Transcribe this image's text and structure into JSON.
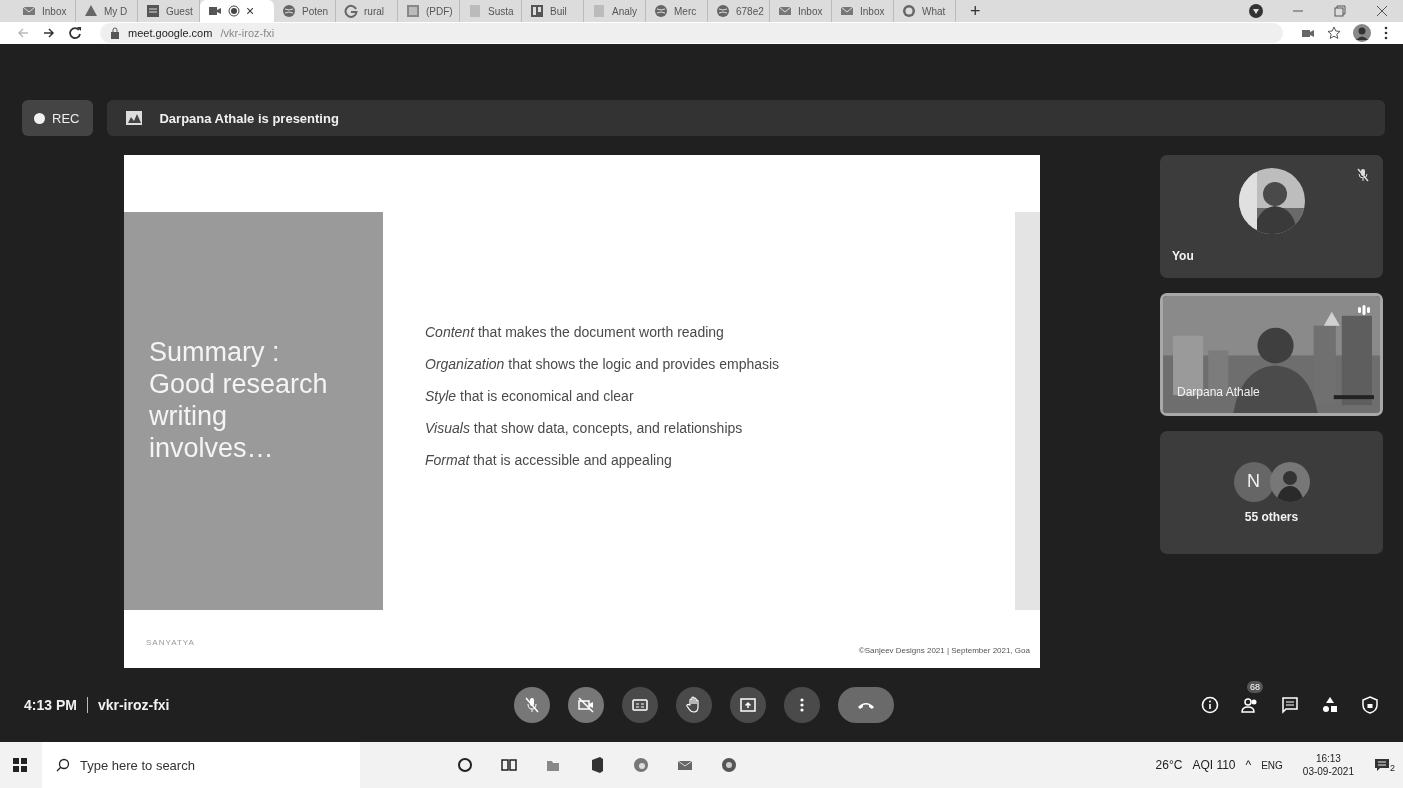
{
  "browser": {
    "tabs": [
      {
        "label": "Inbox",
        "selected": false
      },
      {
        "label": "My D",
        "selected": false
      },
      {
        "label": "Guest",
        "selected": false
      },
      {
        "close": "×",
        "selected": true
      },
      {
        "label": "Poten",
        "selected": false
      },
      {
        "label": "rural",
        "selected": false
      },
      {
        "label": "(PDF)",
        "selected": false
      },
      {
        "label": "Susta",
        "selected": false
      },
      {
        "label": "Buil",
        "selected": false
      },
      {
        "label": "Analy",
        "selected": false
      },
      {
        "label": "Merc",
        "selected": false
      },
      {
        "label": "678e2",
        "selected": false
      },
      {
        "label": "Inbox",
        "selected": false
      },
      {
        "label": "Inbox",
        "selected": false
      },
      {
        "label": "What",
        "selected": false
      }
    ],
    "new_tab": "+",
    "url_domain": "meet.google.com",
    "url_path": "/vkr-iroz-fxi"
  },
  "meet": {
    "recording_label": "REC",
    "presenter_banner": "Darpana Athale is presenting",
    "slide": {
      "title_lines": [
        "Summary :",
        "Good research",
        "writing",
        "involves…"
      ],
      "bullets": [
        "*Content* that makes the document worth reading",
        "*Organization* that shows the logic and provides emphasis",
        "*Style* that is economical and clear",
        "*Visuals* that show data, concepts, and relationships",
        "*Format* that is accessible and appealing"
      ],
      "logo": "SANYATYA",
      "footer": "©Sanjeev Designs 2021 | September 2021, Goa"
    },
    "tiles": [
      {
        "kind": "self",
        "name": "You",
        "muted": true
      },
      {
        "kind": "video",
        "name": "Darpana Athale",
        "speaking": true
      },
      {
        "kind": "others",
        "initial": "N",
        "label": "55 others"
      }
    ],
    "time": "4:13 PM",
    "meeting_code": "vkr-iroz-fxi",
    "controls": [
      {
        "kind": "mic",
        "on": false
      },
      {
        "kind": "camera",
        "on": false
      },
      {
        "kind": "captions"
      },
      {
        "kind": "hand"
      },
      {
        "kind": "present"
      },
      {
        "kind": "more"
      },
      {
        "kind": "leave"
      }
    ],
    "side_controls": [
      {
        "kind": "info"
      },
      {
        "kind": "people",
        "badge": "68"
      },
      {
        "kind": "chat"
      },
      {
        "kind": "activities"
      },
      {
        "kind": "safety"
      }
    ]
  },
  "taskbar": {
    "search_placeholder": "Type here to search",
    "weather": "26°C",
    "aqi": "AQI 110",
    "tray_caret": "^",
    "language": "ENG",
    "time": "16:13",
    "date": "03-09-2021",
    "notifications": "2"
  }
}
